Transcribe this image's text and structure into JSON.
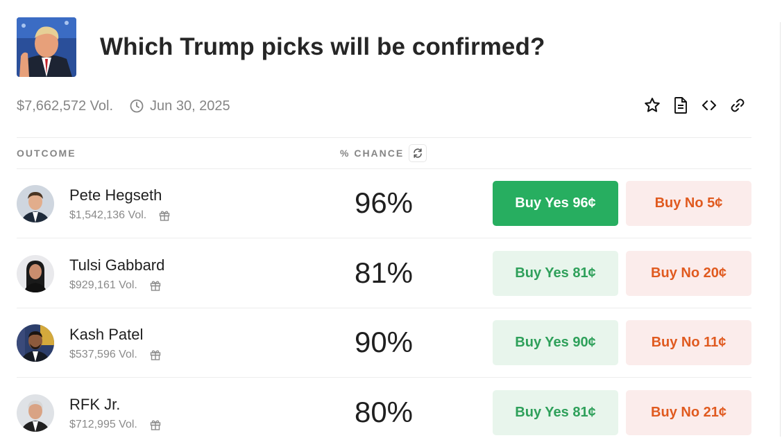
{
  "market": {
    "title": "Which Trump picks will be confirmed?",
    "volume": "$7,662,572 Vol.",
    "end_date": "Jun 30, 2025"
  },
  "actions": {
    "icons": [
      "star-icon",
      "document-icon",
      "code-icon",
      "link-icon"
    ]
  },
  "table": {
    "outcome_header": "OUTCOME",
    "chance_header": "% CHANCE"
  },
  "outcomes": [
    {
      "name": "Pete Hegseth",
      "volume": "$1,542,136 Vol.",
      "chance": "96%",
      "yes_label": "Buy Yes 96¢",
      "no_label": "Buy No 5¢",
      "yes_active": true
    },
    {
      "name": "Tulsi Gabbard",
      "volume": "$929,161 Vol.",
      "chance": "81%",
      "yes_label": "Buy Yes 81¢",
      "no_label": "Buy No 20¢",
      "yes_active": false
    },
    {
      "name": "Kash Patel",
      "volume": "$537,596 Vol.",
      "chance": "90%",
      "yes_label": "Buy Yes 90¢",
      "no_label": "Buy No 11¢",
      "yes_active": false
    },
    {
      "name": "RFK Jr.",
      "volume": "$712,995 Vol.",
      "chance": "80%",
      "yes_label": "Buy Yes 81¢",
      "no_label": "Buy No 21¢",
      "yes_active": false
    }
  ],
  "colors": {
    "yes_active_bg": "#27ae60",
    "yes_bg": "#e8f5ec",
    "yes_text": "#2ea05a",
    "no_bg": "#fbeceb",
    "no_text": "#e05a1f"
  }
}
